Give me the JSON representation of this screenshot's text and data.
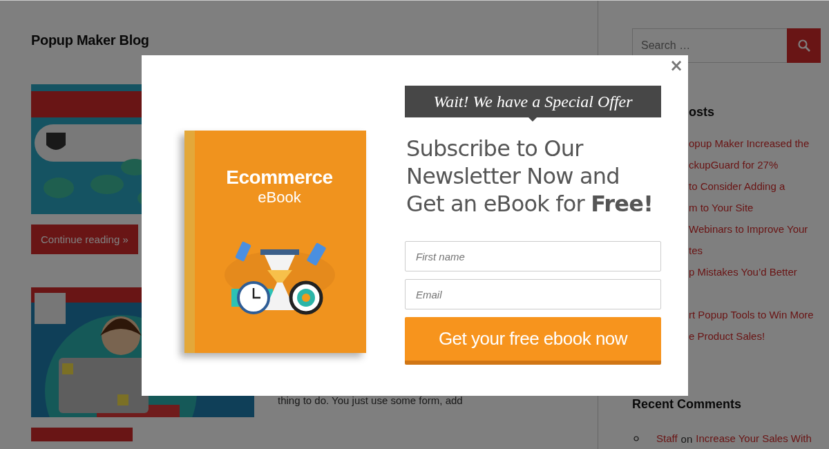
{
  "blog": {
    "title": "Popup Maker Blog",
    "posts": [
      {
        "kind": "picture",
        "button": "Continue reading »"
      },
      {
        "kind": "picture",
        "excerpt": "thing to do. You just use some form, add"
      }
    ]
  },
  "sidebar": {
    "search": {
      "placeholder": "Search …"
    },
    "recent_posts": {
      "heading": "osts",
      "items": [
        {
          "lines": [
            "opup Maker Increased the",
            "ckupGuard for 27%"
          ]
        },
        {
          "lines": [
            "to Consider Adding a",
            "m to Your Site"
          ]
        },
        {
          "lines": [
            "Webinars to Improve Your",
            "tes"
          ]
        },
        {
          "lines": [
            "p Mistakes You’d Better"
          ]
        },
        {
          "lines": [
            "rt Popup Tools to Win More",
            "e Product Sales!"
          ]
        }
      ]
    },
    "recent_comments": {
      "heading": "Recent Comments",
      "items": [
        {
          "author": "Staff",
          "on": "on",
          "post": "Increase Your Sales With"
        }
      ]
    }
  },
  "popup": {
    "close": "×",
    "book": {
      "title": "Ecommerce",
      "subtitle": "eBook"
    },
    "ribbon": "Wait! We have a Special Offer",
    "heading": "Subscribe to Our Newsletter Now and Get an eBook for **Free!**",
    "fields": [
      {
        "placeholder": "First name"
      },
      {
        "placeholder": "Email"
      }
    ],
    "button": "Get your free ebook now"
  }
}
